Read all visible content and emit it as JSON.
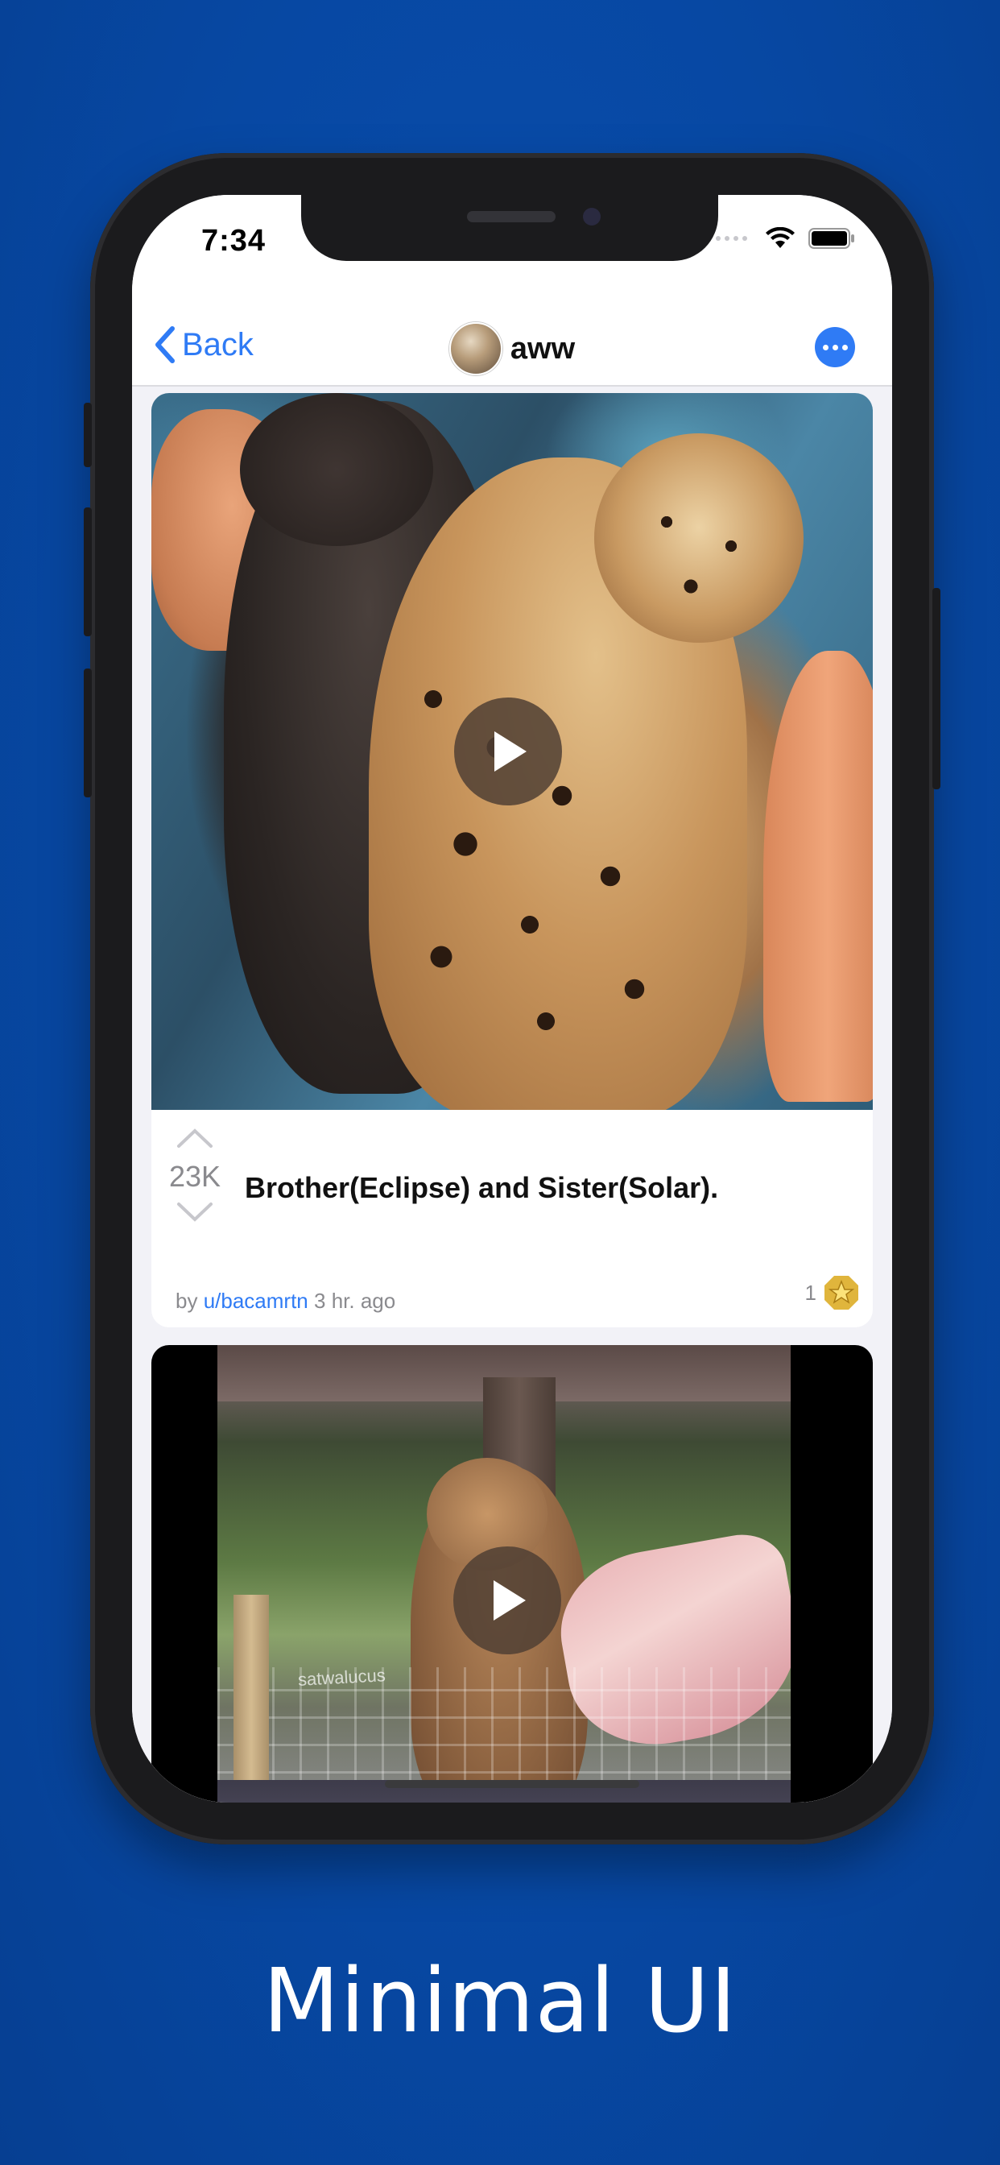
{
  "status_bar": {
    "time": "7:34"
  },
  "nav": {
    "back_label": "Back",
    "title": "aww",
    "back_icon": "chevron-left-icon",
    "more_icon": "ellipsis-circle-icon"
  },
  "posts": [
    {
      "score": "23K",
      "title": "Brother(Eclipse) and Sister(Solar).",
      "meta_by": "by",
      "author": "u/bacamrtn",
      "age": "3 hr. ago",
      "award_count": "1",
      "award_icon": "gold-star-award-icon"
    },
    {
      "watermark": "satwalucus"
    }
  ],
  "tagline": "Minimal UI",
  "colors": {
    "background": "#0748a3",
    "accent": "#2f7bf5",
    "meta_text": "#8a8a8e"
  }
}
